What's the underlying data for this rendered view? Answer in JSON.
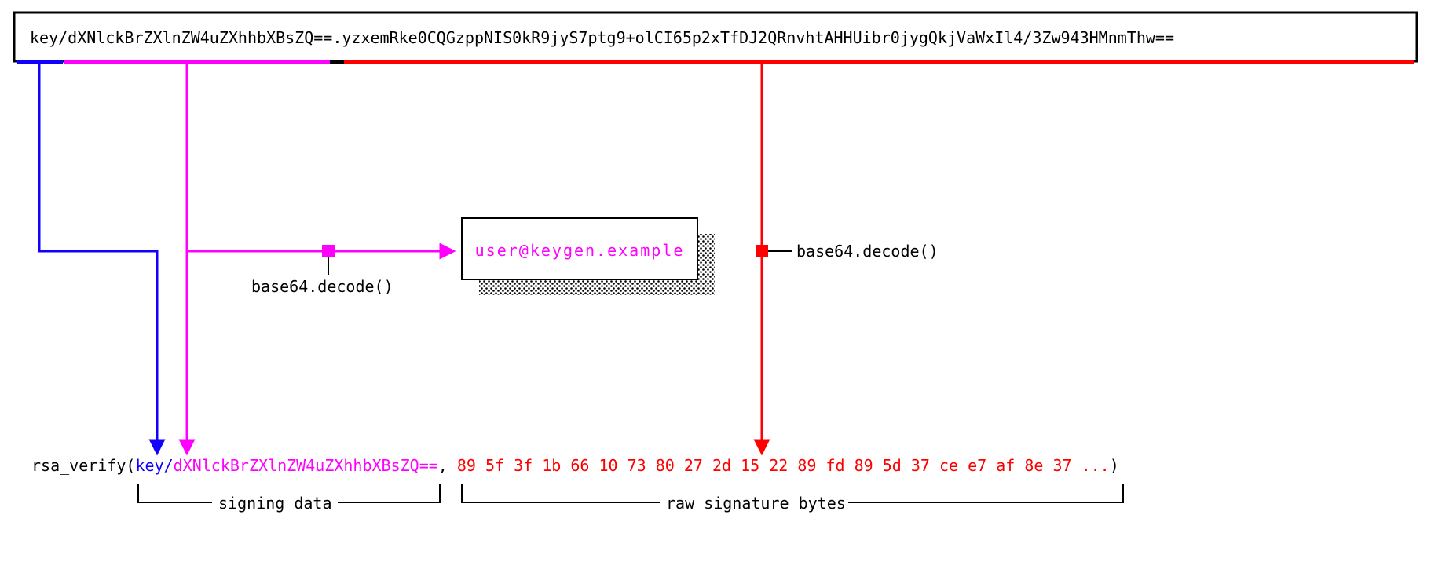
{
  "colors": {
    "blue": "#1200ff",
    "magenta": "#ff00ff",
    "red": "#ff0000",
    "black": "#000000"
  },
  "top_box": {
    "prefix": "key/",
    "b64_user": "dXNlckBrZXlnZW4uZXhhbXBsZQ==",
    "dot": ".",
    "b64_sig": "yzxemRke0CQGzppNIS0kR9jyS7ptg9+olCI65p2xTfDJ2QRnvhtAHHUibr0jygQkjVaWxIl4/3Zw943HMnmThw=="
  },
  "decoded_user_box": "user@keygen.example",
  "labels": {
    "base64_decode_left": "base64.decode()",
    "base64_decode_right": "base64.decode()",
    "signing_data": "signing data",
    "raw_sig": "raw signature bytes"
  },
  "rsa_line": {
    "fn_open": "rsa_verify(",
    "prefix": "key/",
    "b64_user": "dXNlckBrZXlnZW4uZXhhbXBsZQ==",
    "comma_space": ", ",
    "hex_bytes": "89 5f 3f 1b 66 10 73 80 27 2d 15 22 89 fd 89 5d 37 ce e7 af 8e 37 ...",
    "close": ")"
  }
}
